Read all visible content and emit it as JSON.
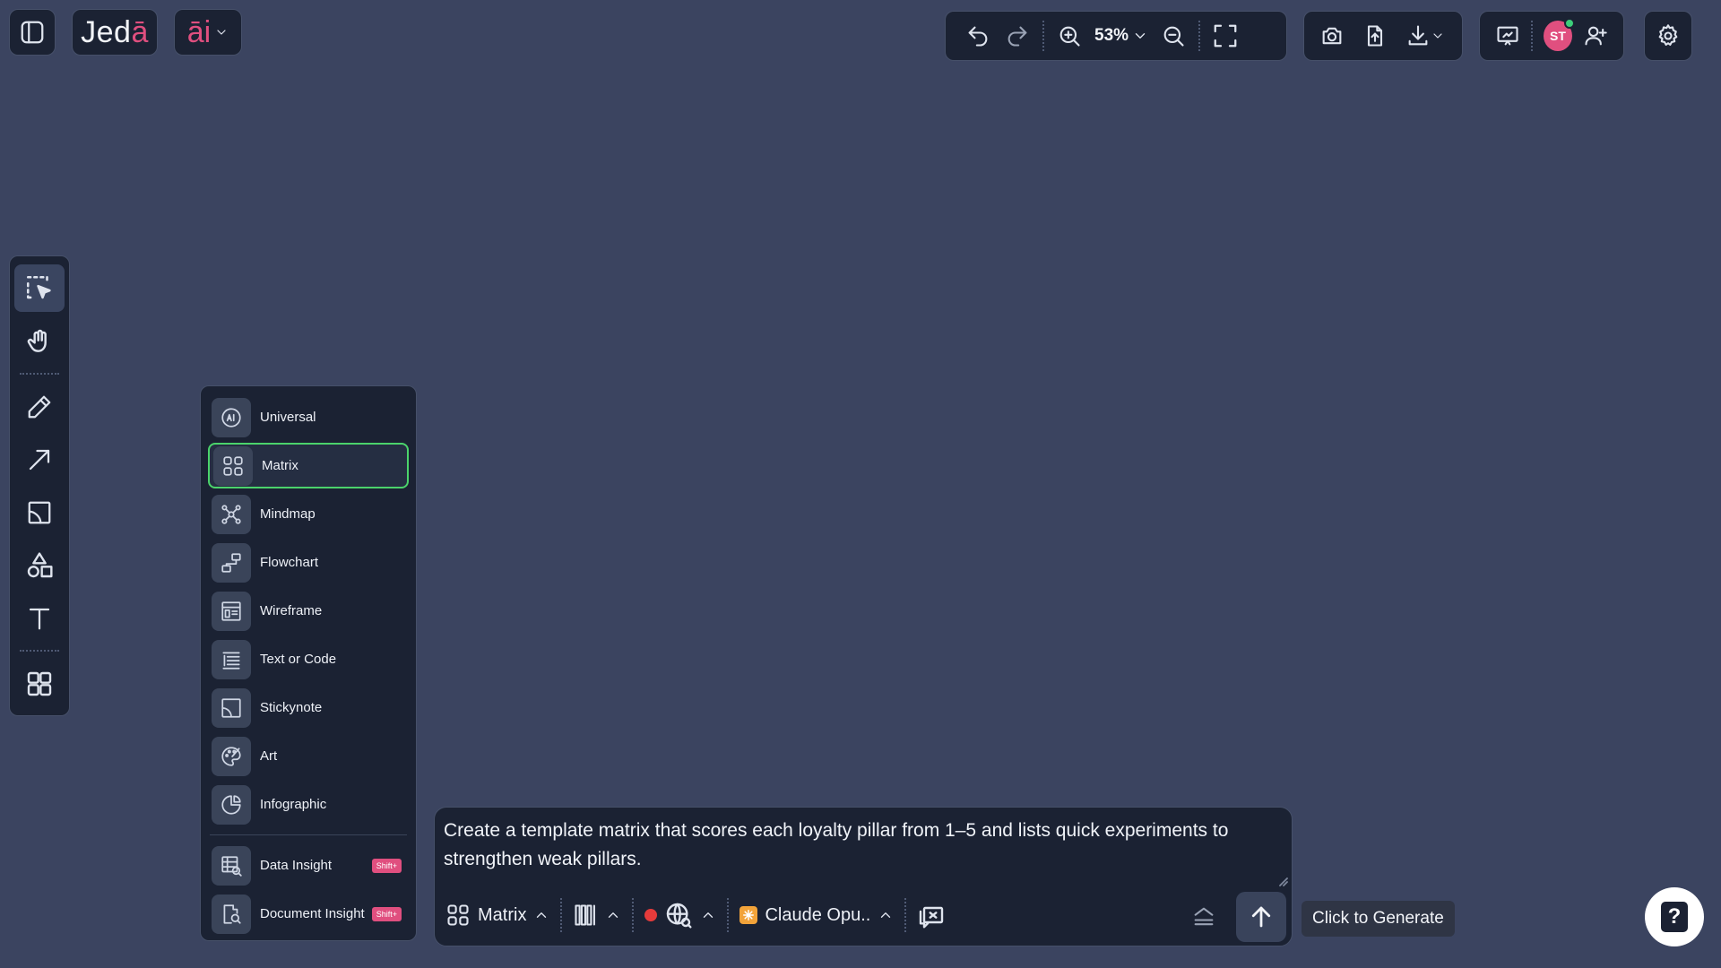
{
  "brand": {
    "logo_main": "Jed",
    "logo_accent": "ā",
    "ai_label": "āi"
  },
  "toolbar": {
    "zoom_level": "53%"
  },
  "user": {
    "initials": "ST"
  },
  "mode_menu": {
    "items": [
      {
        "label": "Universal",
        "icon": "ai-circle-icon"
      },
      {
        "label": "Matrix",
        "icon": "grid-icon",
        "active": true
      },
      {
        "label": "Mindmap",
        "icon": "mindmap-icon"
      },
      {
        "label": "Flowchart",
        "icon": "flowchart-icon"
      },
      {
        "label": "Wireframe",
        "icon": "wireframe-icon"
      },
      {
        "label": "Text or Code",
        "icon": "text-lines-icon"
      },
      {
        "label": "Stickynote",
        "icon": "stickynote-icon"
      },
      {
        "label": "Art",
        "icon": "palette-icon"
      },
      {
        "label": "Infographic",
        "icon": "pie-chart-icon"
      }
    ],
    "insights": [
      {
        "label": "Data Insight",
        "badge": "Shift+",
        "icon": "data-table-icon"
      },
      {
        "label": "Document Insight",
        "badge": "Shift+",
        "icon": "document-search-icon"
      }
    ]
  },
  "prompt": {
    "text": "Create a template matrix that scores each loyalty pillar from 1–5 and lists quick experiments to strengthen weak pillars.",
    "mode_label": "Matrix",
    "model_label": "Claude Opu..",
    "tooltip": "Click to Generate"
  },
  "help": {
    "label": "?"
  },
  "colors": {
    "background": "#3b4460",
    "panel": "#1b2233",
    "accent": "#e04f7f",
    "active_border": "#4bd36b"
  }
}
